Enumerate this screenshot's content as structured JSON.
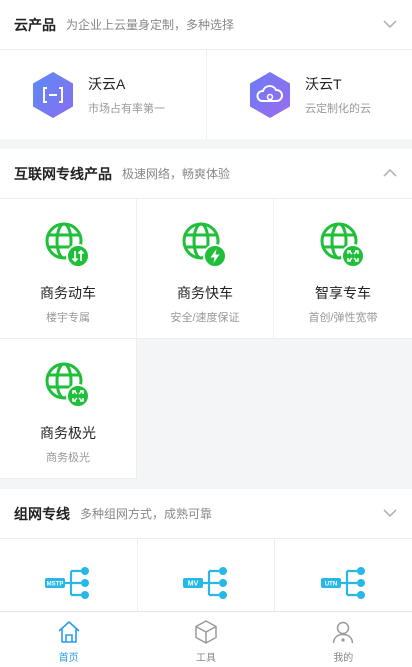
{
  "cloud_products": {
    "title": "云产品",
    "subtitle": "为企业上云量身定制，多种选择",
    "items": [
      {
        "name": "沃云A",
        "desc": "市场占有率第一",
        "icon": "bracket-code-icon"
      },
      {
        "name": "沃云T",
        "desc": "云定制化的云",
        "icon": "cloud-icon"
      }
    ]
  },
  "internet_lines": {
    "title": "互联网专线产品",
    "subtitle": "极速网络，畅爽体验",
    "items": [
      {
        "name": "商务动车",
        "desc": "楼宇专属",
        "icon": "globe-arrows-icon"
      },
      {
        "name": "商务快车",
        "desc": "安全/速度保证",
        "icon": "globe-lightning-icon"
      },
      {
        "name": "智享专车",
        "desc": "首创/弹性宽带",
        "icon": "globe-expand-icon"
      },
      {
        "name": "商务极光",
        "desc": "商务极光",
        "icon": "globe-expand-icon"
      }
    ]
  },
  "networking_lines": {
    "title": "组网专线",
    "subtitle": "多种组网方式，成熟可靠",
    "items": [
      {
        "label": "MSTP",
        "icon": "network-tree-icon"
      },
      {
        "label": "MV",
        "icon": "network-tree-icon"
      },
      {
        "label": "UTN",
        "icon": "network-tree-icon"
      }
    ]
  },
  "tabbar": {
    "items": [
      {
        "label": "首页",
        "icon": "home-icon",
        "active": true
      },
      {
        "label": "工具",
        "icon": "cube-icon",
        "active": false
      },
      {
        "label": "我的",
        "icon": "user-icon",
        "active": false
      }
    ]
  },
  "colors": {
    "accent_blue": "#2a9cf0",
    "green": "#1fbf3a",
    "purple_gradient_start": "#5b8cf5",
    "purple_gradient_end": "#8a6cf0",
    "cyan": "#27b8e8"
  }
}
